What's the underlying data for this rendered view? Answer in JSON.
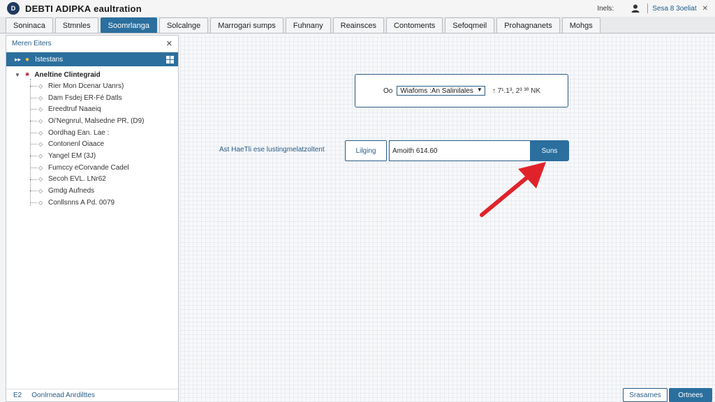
{
  "window": {
    "title": "DEBTI ADIPKA eaultration",
    "app_icon_letter": "D",
    "right_label": "Inels:",
    "link": "Sesa 8 3oeliat",
    "close": "✕"
  },
  "tabs": [
    {
      "label": "Soninaca",
      "active": false
    },
    {
      "label": "Stmnles",
      "active": false
    },
    {
      "label": "Soomrlanga",
      "active": true
    },
    {
      "label": "Solcalnge",
      "active": false
    },
    {
      "label": "Marrogari sumps",
      "active": false
    },
    {
      "label": "Fuhnany",
      "active": false
    },
    {
      "label": "Reainsces",
      "active": false
    },
    {
      "label": "Contoments",
      "active": false
    },
    {
      "label": "Sefoqmeil",
      "active": false
    },
    {
      "label": "Prohagnanets",
      "active": false
    },
    {
      "label": "Mohgs",
      "active": false
    }
  ],
  "sidebar": {
    "title": "Meren Eiters",
    "close": "✕",
    "selected": "Istestans",
    "root": "Aneltine Clintegraid",
    "items": [
      "Rier Mon Dcenar Uanrs)",
      "Dam Fsdej ER-Fé Datls",
      "Ereedtruf Naaeiq",
      "Oi'Negnrul, Malsedne PR, (D9)",
      "Oordhag Ean. Lae :",
      "Contonenl Oiaace",
      "Yangel EM (3J)",
      "Fumccy eCorvande Cadel",
      "Secoh EVL. LNr62",
      "Gmdg Aufneds",
      "Conllsnns A Pd. 0079"
    ],
    "footer_num": "E2",
    "footer_label": "Oonlrnead Anrdilttes"
  },
  "filter": {
    "label": "Oo",
    "selected": "Wiafoms :An Salinilales",
    "info": "↑ 7¹.1³, 2³ ³º NK"
  },
  "action": {
    "label": "Ast HaeTli ese lustingmelatzoltent",
    "select_button": "Lilging",
    "amount_value": "Amoith 614.60",
    "send_button": "Suns"
  },
  "bottom": {
    "secondary": "Srasarnes",
    "primary": "Ortnees"
  },
  "colors": {
    "accent": "#2b6f9e",
    "arrow": "#e0232a"
  }
}
